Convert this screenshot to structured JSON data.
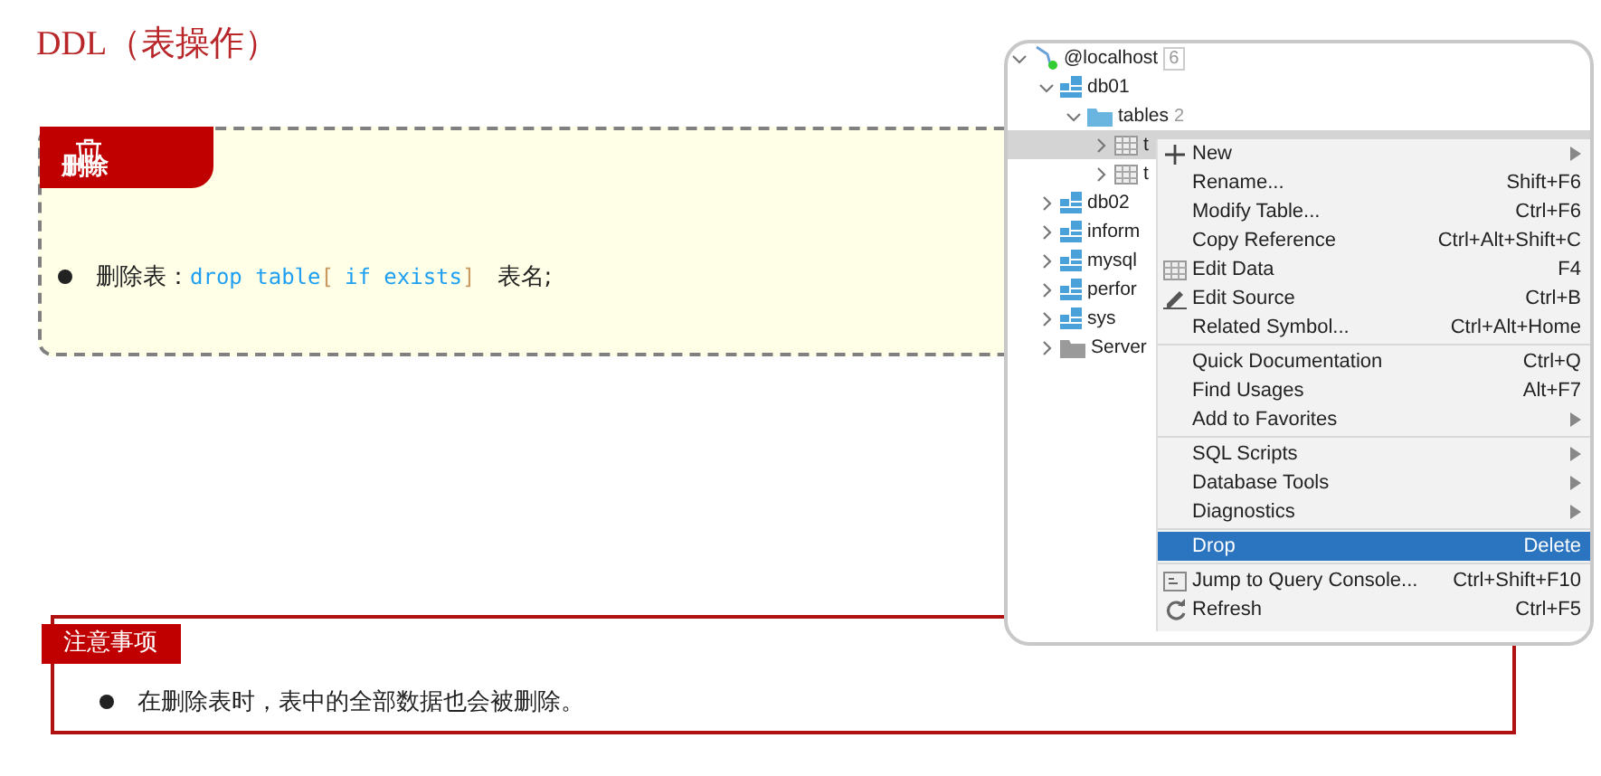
{
  "title": "DDL（表操作）",
  "delete_card": {
    "tag": "删除",
    "bullets": [
      {
        "parts": [
          {
            "kind": "text",
            "text": "删除表："
          },
          {
            "kind": "code",
            "text": "drop table"
          },
          {
            "kind": "bracket",
            "text": "["
          },
          {
            "kind": "code",
            "text": "if exists"
          },
          {
            "kind": "bracket",
            "text": "]"
          },
          {
            "kind": "text",
            "text": "表名;"
          }
        ]
      }
    ]
  },
  "note": {
    "tag": "注意事项",
    "bullets": [
      "在删除表时，表中的全部数据也会被删除。"
    ]
  },
  "ide": {
    "tree": [
      {
        "kind": "host",
        "label": "@localhost",
        "count": "6",
        "expanded": true,
        "selected": false,
        "children": [
          {
            "kind": "database",
            "label": "db01",
            "expanded": true,
            "selected": false,
            "children": [
              {
                "kind": "folder",
                "label": "tables",
                "count": "2",
                "expanded": true,
                "selected": false,
                "children": [
                  {
                    "kind": "table",
                    "label": "t",
                    "expanded": false,
                    "selected": true
                  },
                  {
                    "kind": "table",
                    "label": "t",
                    "expanded": false,
                    "selected": false
                  }
                ]
              }
            ]
          },
          {
            "kind": "database",
            "label": "db02",
            "expanded": false,
            "selected": false
          },
          {
            "kind": "database",
            "label": "inform",
            "expanded": false,
            "selected": false
          },
          {
            "kind": "database",
            "label": "mysql",
            "expanded": false,
            "selected": false
          },
          {
            "kind": "database",
            "label": "perfor",
            "expanded": false,
            "selected": false
          },
          {
            "kind": "database",
            "label": "sys",
            "expanded": false,
            "selected": false
          },
          {
            "kind": "group",
            "label": "Server",
            "expanded": false,
            "selected": false
          }
        ]
      }
    ],
    "menu": [
      {
        "kind": "item",
        "label": "New",
        "submenu": true,
        "selected": false
      },
      {
        "kind": "item",
        "label": "Rename...",
        "shortcut": "Shift+F6",
        "selected": false
      },
      {
        "kind": "item",
        "label": "Modify Table...",
        "shortcut": "Ctrl+F6",
        "selected": false
      },
      {
        "kind": "item",
        "label": "Copy Reference",
        "shortcut": "Ctrl+Alt+Shift+C",
        "selected": false
      },
      {
        "kind": "item",
        "label": "Edit Data",
        "shortcut": "F4",
        "selected": false
      },
      {
        "kind": "item",
        "label": "Edit Source",
        "shortcut": "Ctrl+B",
        "selected": false
      },
      {
        "kind": "item",
        "label": "Related Symbol...",
        "shortcut": "Ctrl+Alt+Home",
        "selected": false
      },
      {
        "kind": "separator"
      },
      {
        "kind": "item",
        "label": "Quick Documentation",
        "shortcut": "Ctrl+Q",
        "selected": false
      },
      {
        "kind": "item",
        "label": "Find Usages",
        "shortcut": "Alt+F7",
        "selected": false
      },
      {
        "kind": "item",
        "label": "Add to Favorites",
        "submenu": true,
        "selected": false
      },
      {
        "kind": "separator"
      },
      {
        "kind": "item",
        "label": "SQL Scripts",
        "submenu": true,
        "selected": false
      },
      {
        "kind": "item",
        "label": "Database Tools",
        "submenu": true,
        "selected": false
      },
      {
        "kind": "item",
        "label": "Diagnostics",
        "submenu": true,
        "selected": false
      },
      {
        "kind": "separator"
      },
      {
        "kind": "item",
        "label": "Drop",
        "shortcut": "Delete",
        "selected": true
      },
      {
        "kind": "separator"
      },
      {
        "kind": "item",
        "label": "Jump to Query Console...",
        "shortcut": "Ctrl+Shift+F10",
        "selected": false
      },
      {
        "kind": "item",
        "label": "Refresh",
        "shortcut": "Ctrl+F5",
        "selected": false
      }
    ]
  }
}
